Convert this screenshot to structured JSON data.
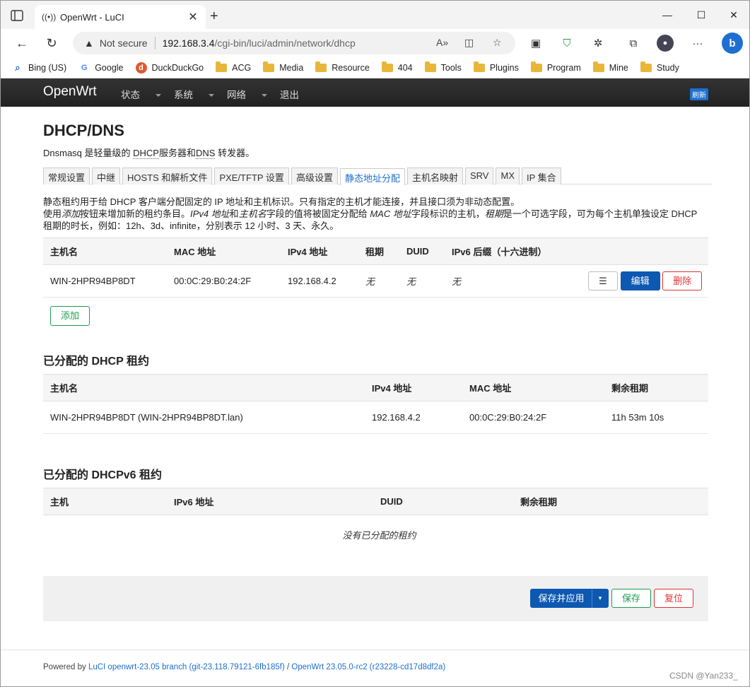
{
  "browser": {
    "tab_title": "OpenWrt - LuCI",
    "not_secure": "Not secure",
    "url_host": "192.168.3.4",
    "url_path": "/cgi-bin/luci/admin/network/dhcp",
    "bookmarks": [
      "Bing (US)",
      "Google",
      "DuckDuckGo",
      "ACG",
      "Media",
      "Resource",
      "404",
      "Tools",
      "Plugins",
      "Program",
      "Mine",
      "Study"
    ]
  },
  "header": {
    "brand": "OpenWrt",
    "menu": [
      "状态",
      "系统",
      "网络",
      "退出"
    ],
    "refresh": "刷新"
  },
  "page": {
    "title": "DHCP/DNS",
    "desc_a": "Dnsmasq 是轻量级的 ",
    "desc_dhcp": "DHCP",
    "desc_b": "服务器和",
    "desc_dns": "DNS",
    "desc_c": " 转发器。",
    "tabs": [
      "常规设置",
      "中继",
      "HOSTS 和解析文件",
      "PXE/TFTP 设置",
      "高级设置",
      "静态地址分配",
      "主机名映射",
      "SRV",
      "MX",
      "IP 集合"
    ],
    "info_line1": "静态租约用于给 DHCP 客户端分配固定的 IP 地址和主机标识。只有指定的主机才能连接，并且接口须为非动态配置。",
    "info_line2_a": "使用",
    "info_add": "添加",
    "info_line2_b": "按钮来增加新的租约条目。",
    "info_ipv4": "IPv4 地址",
    "info_and": "和",
    "info_hostname": "主机名",
    "info_line2_c": "字段的值将被固定分配给 ",
    "info_mac": "MAC 地址",
    "info_line2_d": "字段标识的主机，",
    "info_lease": "租期",
    "info_line2_e": "是一个可选字段，可为每个主机单独设定 DHCP",
    "info_line3": "租期的时长，例如：12h、3d、infinite，分别表示 12 小时、3 天、永久。"
  },
  "static_table": {
    "headers": [
      "主机名",
      "MAC 地址",
      "IPv4 地址",
      "租期",
      "DUID",
      "IPv6 后缀（十六进制）"
    ],
    "row": {
      "host": "WIN-2HPR94BP8DT",
      "mac": "00:0C:29:B0:24:2F",
      "ipv4": "192.168.4.2",
      "lease": "无",
      "duid": "无",
      "ipv6": "无"
    },
    "btn_menu": "☰",
    "btn_edit": "编辑",
    "btn_delete": "删除",
    "btn_add": "添加"
  },
  "dhcp_leases": {
    "title": "已分配的 DHCP 租约",
    "headers": [
      "主机名",
      "IPv4 地址",
      "MAC 地址",
      "剩余租期"
    ],
    "row": {
      "host": "WIN-2HPR94BP8DT (WIN-2HPR94BP8DT.lan)",
      "ipv4": "192.168.4.2",
      "mac": "00:0C:29:B0:24:2F",
      "remain": "11h 53m 10s"
    }
  },
  "dhcpv6_leases": {
    "title": "已分配的 DHCPv6 租约",
    "headers": [
      "主机",
      "IPv6 地址",
      "DUID",
      "剩余租期"
    ],
    "empty": "没有已分配的租约"
  },
  "actions": {
    "save_apply": "保存并应用",
    "save": "保存",
    "reset": "复位"
  },
  "footer": {
    "powered": "Powered by ",
    "luci": "LuCI openwrt-23.05 branch (git-23.118.79121-6fb185f)",
    "slash": " / ",
    "openwrt": "OpenWrt 23.05.0-rc2 (r23228-cd17d8df2a)"
  },
  "watermark": "CSDN @Yan233_"
}
